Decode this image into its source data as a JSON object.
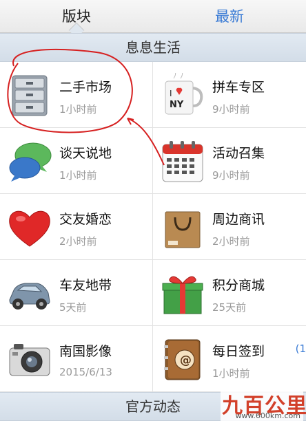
{
  "tabs": {
    "left": "版块",
    "right": "最新"
  },
  "sections": {
    "top": "息息生活",
    "bottom": "官方动态"
  },
  "cells": [
    {
      "title": "二手市场",
      "time": "1小时前",
      "icon": "filing-cabinet-icon"
    },
    {
      "title": "拼车专区",
      "time": "9小时前",
      "icon": "coffee-mug-icon"
    },
    {
      "title": "谈天说地",
      "time": "1小时前",
      "icon": "chat-bubbles-icon"
    },
    {
      "title": "活动召集",
      "time": "9小时前",
      "icon": "calendar-icon"
    },
    {
      "title": "交友婚恋",
      "time": "2小时前",
      "icon": "heart-icon"
    },
    {
      "title": "周边商讯",
      "time": "2小时前",
      "icon": "shopping-bag-icon"
    },
    {
      "title": "车友地带",
      "time": "5天前",
      "icon": "car-icon"
    },
    {
      "title": "积分商城",
      "time": "25天前",
      "icon": "gift-box-icon"
    },
    {
      "title": "南国影像",
      "time": "2015/6/13",
      "icon": "camera-icon"
    },
    {
      "title": "每日签到",
      "time": "1小时前",
      "icon": "address-book-icon",
      "badge": "(1"
    }
  ],
  "watermark": {
    "logo": "九百公里",
    "url": "www.600km.com"
  },
  "colors": {
    "tab_active": "#3a7bd5",
    "section_bg": "#d9e2ec",
    "annotation": "#d62020"
  }
}
